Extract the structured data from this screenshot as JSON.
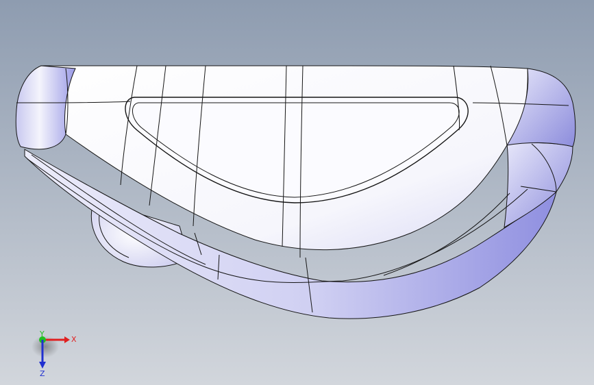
{
  "viewport": {
    "background_top": "#8e9cb0",
    "background_bottom": "#d2d6dc"
  },
  "model": {
    "edge_color": "#141414",
    "face_light": "#ffffff",
    "face_shade": "#9a9ae6"
  },
  "triad": {
    "x_label": "X",
    "y_label": "Y",
    "z_label": "Z",
    "x_color": "#e02020",
    "y_color": "#20c020",
    "z_color": "#2030d0"
  }
}
